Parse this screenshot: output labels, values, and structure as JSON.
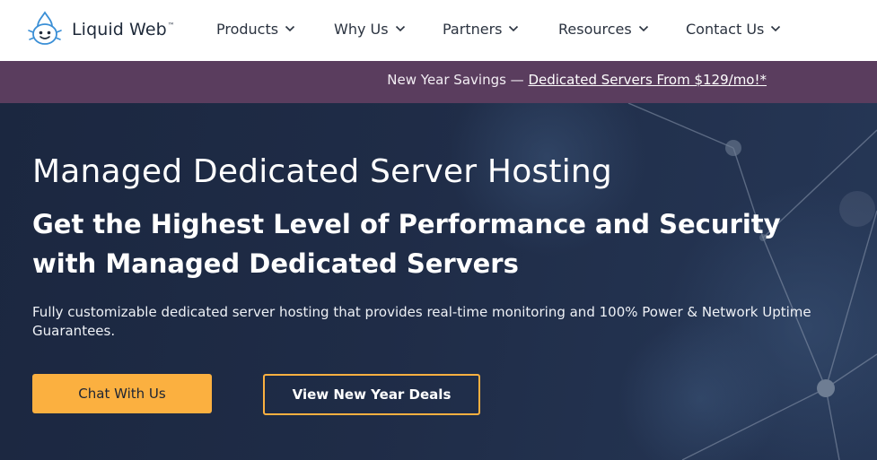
{
  "header": {
    "logo": {
      "name": "Liquid Web",
      "trademark": "™",
      "icon": "liquid-web-logo-icon"
    },
    "nav": [
      {
        "label": "Products",
        "icon": "chevron-down-icon"
      },
      {
        "label": "Why Us",
        "icon": "chevron-down-icon"
      },
      {
        "label": "Partners",
        "icon": "chevron-down-icon"
      },
      {
        "label": "Resources",
        "icon": "chevron-down-icon"
      },
      {
        "label": "Contact Us",
        "icon": "chevron-down-icon"
      }
    ]
  },
  "promo": {
    "prefix": "New Year Savings — ",
    "link_label": "Dedicated Servers From $129/mo!*"
  },
  "hero": {
    "title": "Managed Dedicated Server Hosting",
    "subtitle": "Get the Highest Level of Performance and Security with Managed Dedicated Servers",
    "description": "Fully customizable dedicated server hosting that provides real-time monitoring and 100% Power & Network Uptime Guarantees.",
    "primary_button": "Chat With Us",
    "secondary_button": "View New Year Deals"
  },
  "colors": {
    "promo_bg": "#5a3d5e",
    "hero_bg": "#1f2c47",
    "accent": "#fbb040",
    "nav_text": "#2b3340"
  }
}
